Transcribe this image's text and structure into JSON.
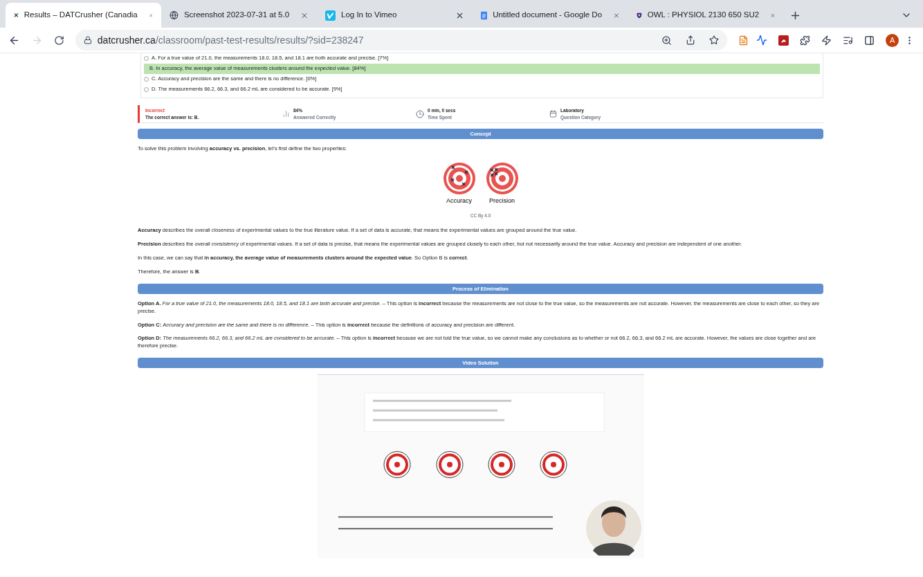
{
  "browser": {
    "tabs": [
      {
        "title": "Results – DATCrusher (Canadia",
        "selected": true
      },
      {
        "title": "Screenshot 2023-07-31 at 5.0",
        "selected": false
      },
      {
        "title": "Log In to Vimeo",
        "selected": false
      },
      {
        "title": "Untitled document - Google Do",
        "selected": false
      },
      {
        "title": "OWL : PHYSIOL 2130 650 SU2",
        "selected": false
      }
    ],
    "address": {
      "domain": "datcrusher.ca",
      "path": "/classroom/past-test-results/results/?sid=238247"
    },
    "profile": "A"
  },
  "options": [
    {
      "label": "A. For a true value of 21.0, the measurements 18.0, 18.5, and 18.1 are both accurate and precise. [7%]",
      "selected": false
    },
    {
      "label": "B. In accuracy, the average value of measurements clusters around the expected value. [84%]",
      "selected": true
    },
    {
      "label": "C. Accuracy and precision are the same and there is no difference. [0%]",
      "selected": false
    },
    {
      "label": "D. The measurements 66.2, 66.3, and 66.2 mL are considered to be accurate. [9%]",
      "selected": false
    }
  ],
  "result": {
    "status": "Incorrect",
    "detail": "The correct answer is: B.",
    "stats": [
      {
        "kind": "chart",
        "value": "84%",
        "label": "Answered Correctly"
      },
      {
        "kind": "clock",
        "value": "0 min, 0 secs",
        "label": "Time Spent"
      },
      {
        "kind": "calendar",
        "value": "Laboratory",
        "label": "Question Category"
      }
    ]
  },
  "sections": [
    {
      "kind": "header",
      "title": "Concept"
    },
    {
      "kind": "text",
      "text": "To solve this problem involving **accuracy vs. precision**, let’s first define the two properties:"
    },
    {
      "kind": "figure",
      "labels": [
        "Accuracy",
        "Precision"
      ],
      "credit": "CC By 4.0"
    },
    {
      "kind": "text",
      "text": "**Accuracy** describes the overall *closeness* of experimental values to the true literature value. If a set of data is accurate, that means the experimental values are grouped around the true value."
    },
    {
      "kind": "text",
      "text": "**Precision** describes the overall *consistency* of experimental values. If a set of data is precise, that means the experimental values are grouped closely to each other, but not necessarily around the true value. Accuracy and precision are independent of one another."
    },
    {
      "kind": "text",
      "text": "In this case, we can say that **in accuracy, the average value of measurements clusters around the expected value**. So Option B is **correct**."
    },
    {
      "kind": "text",
      "text": "Therefore, the answer is **B**."
    },
    {
      "kind": "header",
      "title": "Process of Elimination"
    },
    {
      "kind": "text",
      "text": "**Option A.** *For a true value of 21.0, the measurements 18.0, 18.5, and 18.1 are both accurate and precise.* – This option is **incorrect** because the measurements are not close to the true value, so the measurements are not accurate. However, the measurements are close to each other, so they are precise."
    },
    {
      "kind": "text",
      "text": "**Option C:** *Accuracy and precision are the same and there is no difference.* – This option is **incorrect** because the definitions of accuracy and precision are different."
    },
    {
      "kind": "text",
      "text": "**Option D:** *The measurements 66.2, 66.3, and 66.2 mL are considered to be accurate.* – This option is **incorrect** because we are not told the true value, so we cannot make any conclusions as to whether or not 66.2, 66.3, and 66.2 mL are accurate. However, the values are close together and are therefore precise."
    },
    {
      "kind": "header",
      "title": "Video Solution"
    },
    {
      "kind": "video"
    }
  ]
}
